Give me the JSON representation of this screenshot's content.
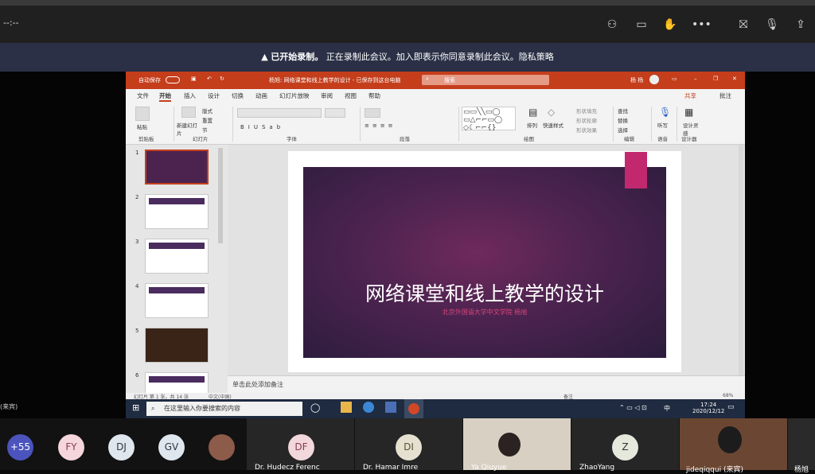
{
  "meeting": {
    "timer": "--:--",
    "record_notice_title": "已开始录制。",
    "record_notice_body": "正在录制此会议。加入即表示你同意录制此会议。隐私策略",
    "left_label": "(来宾)"
  },
  "ppt": {
    "autosave": "自动保存",
    "title_bar": "杨旭: 网络课堂和线上教学的设计 - 已保存到这台电脑",
    "search_placeholder": "搜索",
    "user": "杨 杨",
    "tabs": [
      "文件",
      "开始",
      "插入",
      "设计",
      "切换",
      "动画",
      "幻灯片放映",
      "审阅",
      "视图",
      "帮助"
    ],
    "share": "共享",
    "comments": "批注",
    "groups": [
      "剪贴板",
      "幻灯片",
      "字体",
      "段落",
      "绘图",
      "编辑",
      "语音",
      "设计器"
    ],
    "buttons": {
      "paste": "粘贴",
      "new_slide": "新建幻灯片",
      "layout": "版式",
      "reset": "重置",
      "section": "节",
      "arrange": "排列",
      "quick_styles": "快速样式",
      "fill": "形状填充",
      "outline": "形状轮廓",
      "effects": "形状效果",
      "find": "查找",
      "replace": "替换",
      "select": "选择",
      "dictate": "听写",
      "designer": "设计灵感"
    },
    "slide_numbers": [
      "1",
      "2",
      "3",
      "4",
      "5",
      "6"
    ],
    "slide_title": "网络课堂和线上教学的设计",
    "slide_subtitle": "北京外国语大学中文学院 杨旭",
    "notes_placeholder": "单击此处添加备注",
    "status_left": "幻灯片 第 1 张，共 14 张",
    "status_lang": "中文(中国)",
    "status_notes": "备注",
    "zoom": "68%"
  },
  "taskbar": {
    "search": "在这里输入你要搜索的内容",
    "time": "17:24",
    "date": "2020/12/12",
    "ime": "中"
  },
  "participants": [
    {
      "initials": "+55",
      "color": "#4b53bc"
    },
    {
      "initials": "FY",
      "color": "#f4d6dc"
    },
    {
      "initials": "DJ",
      "color": "#dfe6ee"
    },
    {
      "initials": "GV",
      "color": "#dfe6ee"
    },
    {
      "initials": "DF",
      "name": "Dr. Hudecz Ferenc",
      "color": "#f2d7dc"
    },
    {
      "initials": "DI",
      "name": "Dr. Hamar Imre",
      "color": "#e6e0d0"
    },
    {
      "name": "Ya Qiuyue"
    },
    {
      "initials": "Z",
      "name": "ZhaoYang",
      "color": "#e5e9dc"
    },
    {
      "name": "jideqiqqui (来宾)"
    },
    {
      "name": "杨旭"
    }
  ]
}
